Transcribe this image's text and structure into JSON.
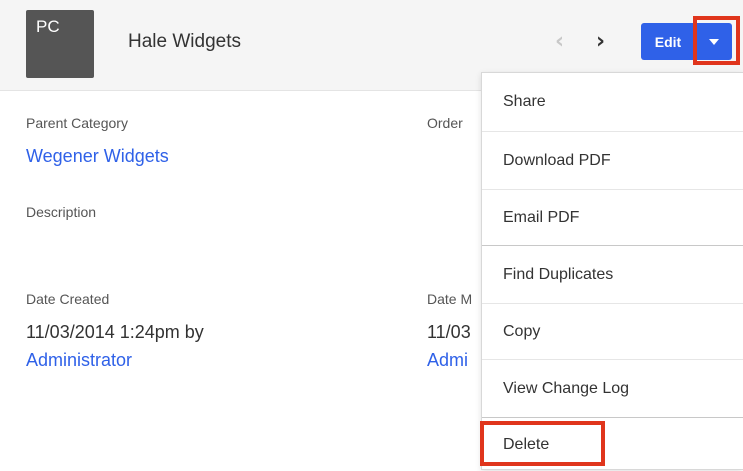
{
  "header": {
    "avatar_text": "PC",
    "record_name": "Hale Widgets",
    "prev_icon": "chevron-left-icon",
    "next_icon": "chevron-right-icon",
    "edit_label": "Edit",
    "caret_icon": "caret-down-icon"
  },
  "fields": {
    "parent_category_label": "Parent Category",
    "parent_category_value": "Wegener Widgets",
    "order_label": "Order",
    "description_label": "Description",
    "date_created_label": "Date Created",
    "date_created_value": "11/03/2014 1:24pm by",
    "date_created_user": "Administrator",
    "date_modified_label": "Date M",
    "date_modified_value": "11/03",
    "date_modified_user": "Admi"
  },
  "menu": {
    "items": [
      "Share",
      "Download PDF",
      "Email PDF",
      "Find Duplicates",
      "Copy",
      "View Change Log",
      "Delete"
    ]
  },
  "colors": {
    "accent": "#2f61e8",
    "highlight": "#e0351c",
    "header_bg": "#f5f5f5",
    "avatar_bg": "#555555"
  }
}
